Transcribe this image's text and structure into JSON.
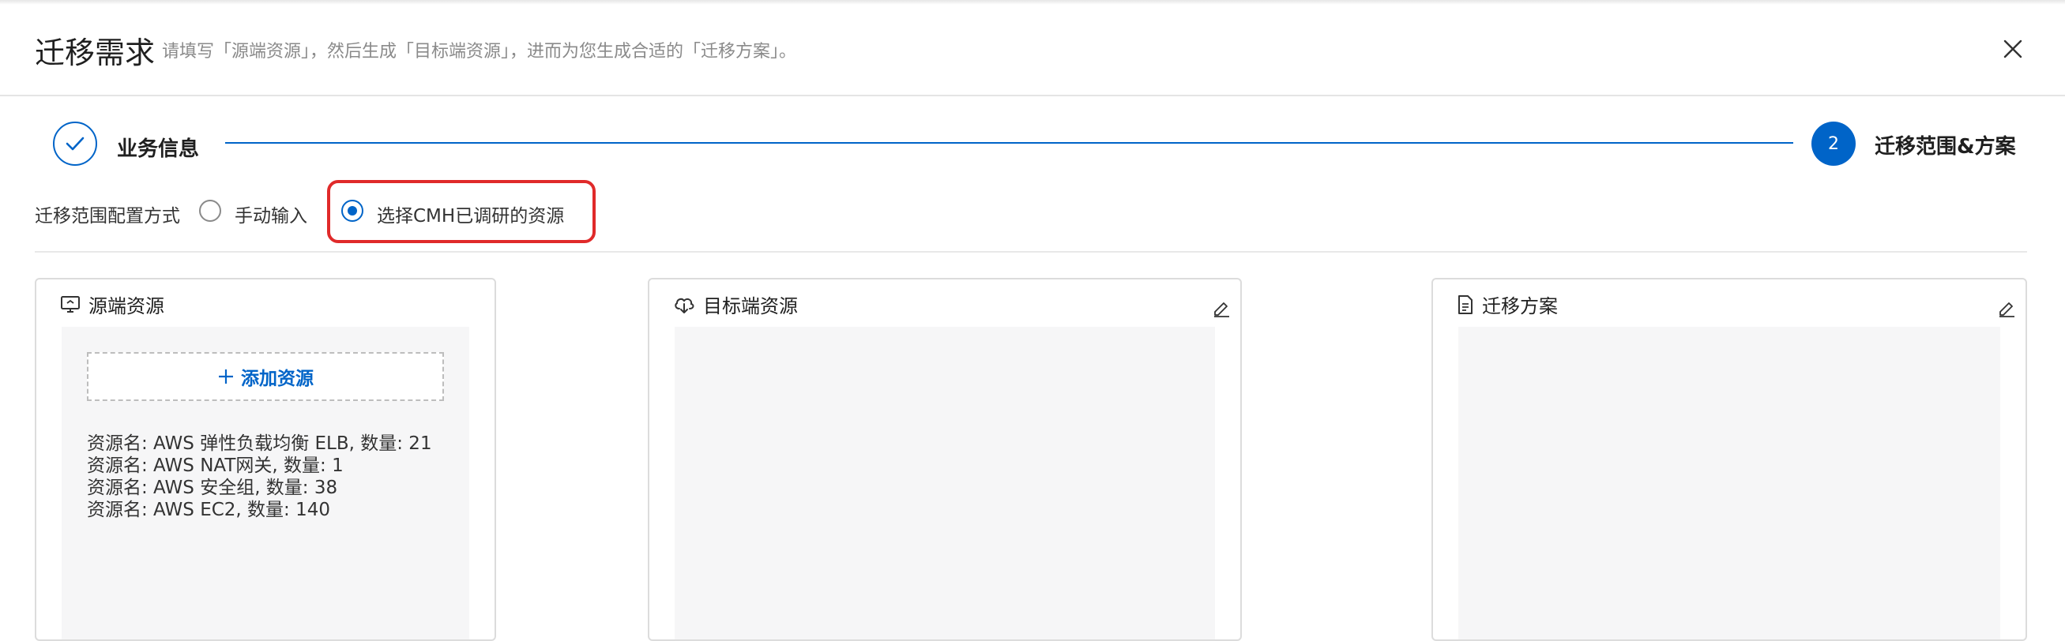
{
  "header": {
    "title": "迁移需求",
    "subtitle": "请填写「源端资源」，然后生成「目标端资源」，进而为您生成合适的「迁移方案」。"
  },
  "steps": [
    {
      "number": "1",
      "label": "业务信息",
      "status": "done"
    },
    {
      "number": "2",
      "label": "迁移范围&方案",
      "status": "active"
    }
  ],
  "config": {
    "label": "迁移范围配置方式",
    "options": [
      {
        "label": "手动输入",
        "checked": false
      },
      {
        "label": "选择CMH已调研的资源",
        "checked": true
      }
    ]
  },
  "panels": {
    "source": {
      "title": "源端资源",
      "icon": "monitor-icon",
      "add_label": "添加资源",
      "resources": [
        "资源名: AWS 弹性负载均衡 ELB, 数量: 21",
        "资源名: AWS NAT网关, 数量: 1",
        "资源名: AWS 安全组, 数量: 38",
        "资源名: AWS EC2, 数量: 140"
      ]
    },
    "target": {
      "title": "目标端资源",
      "icon": "cloud-download-icon"
    },
    "plan": {
      "title": "迁移方案",
      "icon": "document-icon"
    }
  },
  "colors": {
    "primary": "#0064c8",
    "highlight": "#e02a2a",
    "panel_body": "#f6f6f7"
  }
}
